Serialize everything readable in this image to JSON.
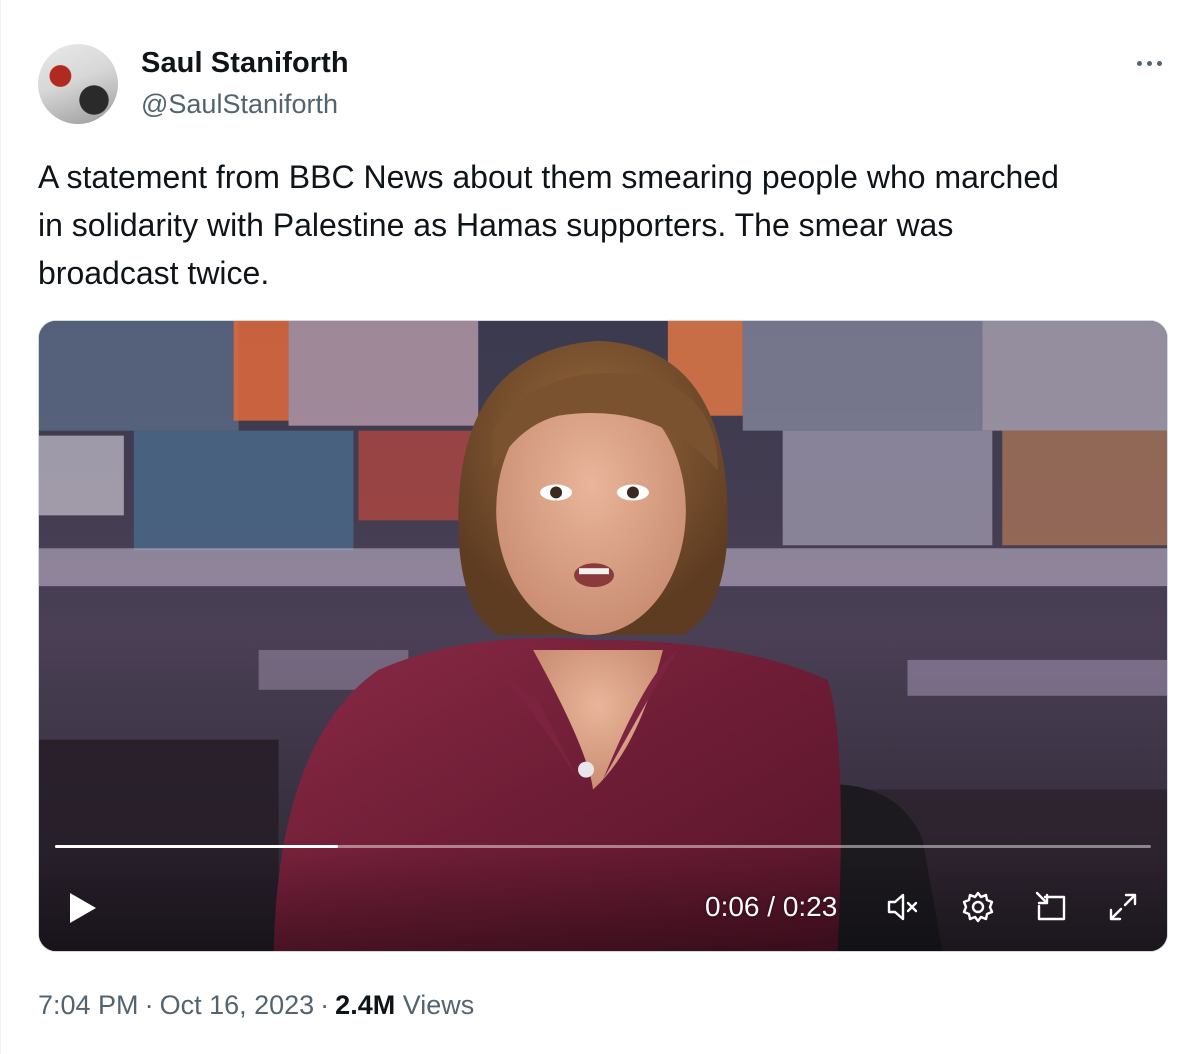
{
  "author": {
    "display_name": "Saul Staniforth",
    "handle": "@SaulStaniforth",
    "avatar_icon": "profile-photo"
  },
  "more_icon": "ellipsis-icon",
  "tweet": {
    "text": "A statement from BBC News about them smearing people who marched\nin solidarity with Palestine as Hamas supporters. The smear was\nbroadcast twice."
  },
  "video": {
    "current_time": "0:06",
    "duration": "0:23",
    "time_label": "0:06 / 0:23",
    "progress": 0.258,
    "muted": true,
    "controls": [
      "play-icon",
      "muted-speaker-icon",
      "settings-gear-icon",
      "picture-in-picture-icon",
      "fullscreen-icon"
    ]
  },
  "meta": {
    "time": "7:04 PM",
    "date": "Oct 16, 2023",
    "separator": "·",
    "views_count": "2.4M",
    "views_label": "Views"
  },
  "colors": {
    "text_primary": "#0f1419",
    "text_secondary": "#536471",
    "border": "#cfd9de"
  }
}
